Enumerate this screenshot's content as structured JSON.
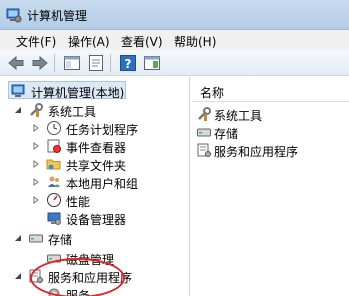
{
  "window": {
    "title": "计算机管理"
  },
  "menu": [
    "文件(F)",
    "操作(A)",
    "查看(V)",
    "帮助(H)"
  ],
  "toolbar": {
    "buttons": [
      "back-icon",
      "forward-icon",
      "show-tree-icon",
      "properties-icon",
      "help-icon",
      "action-pane-icon"
    ]
  },
  "tree": {
    "root": "计算机管理(本地)",
    "system_tools": "系统工具",
    "task_scheduler": "任务计划程序",
    "event_viewer": "事件查看器",
    "shared_folders": "共享文件夹",
    "local_users": "本地用户和组",
    "performance": "性能",
    "device_manager": "设备管理器",
    "storage": "存储",
    "disk_management": "磁盘管理",
    "services_apps": "服务和应用程序",
    "services": "服务"
  },
  "list": {
    "header": "名称",
    "items": [
      "系统工具",
      "存储",
      "服务和应用程序"
    ]
  },
  "colors": {
    "highlight": "#e0242b",
    "selection": "#dbe8f6"
  }
}
